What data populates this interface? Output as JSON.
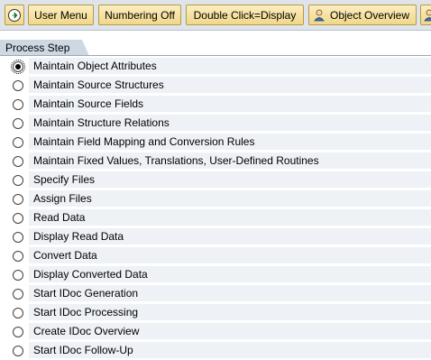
{
  "toolbar": {
    "buttons": [
      {
        "name": "execute-button",
        "icon": "clock-execute-icon",
        "label": ""
      },
      {
        "name": "user-menu-button",
        "label": "User Menu"
      },
      {
        "name": "numbering-off-button",
        "label": "Numbering Off"
      },
      {
        "name": "double-click-display-button",
        "label": "Double Click=Display"
      },
      {
        "name": "object-overview-button",
        "icon": "person-icon",
        "label": "Object Overview"
      },
      {
        "name": "more-button",
        "icon": "person-icon",
        "label": ""
      }
    ]
  },
  "section": {
    "title": "Process Step"
  },
  "steps": [
    {
      "label": "Maintain Object Attributes",
      "selected": true
    },
    {
      "label": "Maintain Source Structures",
      "selected": false
    },
    {
      "label": "Maintain Source Fields",
      "selected": false
    },
    {
      "label": "Maintain Structure Relations",
      "selected": false
    },
    {
      "label": "Maintain Field Mapping and Conversion Rules",
      "selected": false
    },
    {
      "label": "Maintain Fixed Values, Translations, User-Defined Routines",
      "selected": false
    },
    {
      "label": "Specify Files",
      "selected": false
    },
    {
      "label": "Assign Files",
      "selected": false
    },
    {
      "label": "Read Data",
      "selected": false
    },
    {
      "label": "Display Read Data",
      "selected": false
    },
    {
      "label": "Convert Data",
      "selected": false
    },
    {
      "label": "Display Converted Data",
      "selected": false
    },
    {
      "label": "Start IDoc Generation",
      "selected": false
    },
    {
      "label": "Start IDoc Processing",
      "selected": false
    },
    {
      "label": "Create IDoc Overview",
      "selected": false
    },
    {
      "label": "Start IDoc Follow-Up",
      "selected": false
    }
  ],
  "colors": {
    "button_bg": "#f0d78a",
    "row_bg": "#eef1f5",
    "header_tab": "#cdd8e3"
  }
}
